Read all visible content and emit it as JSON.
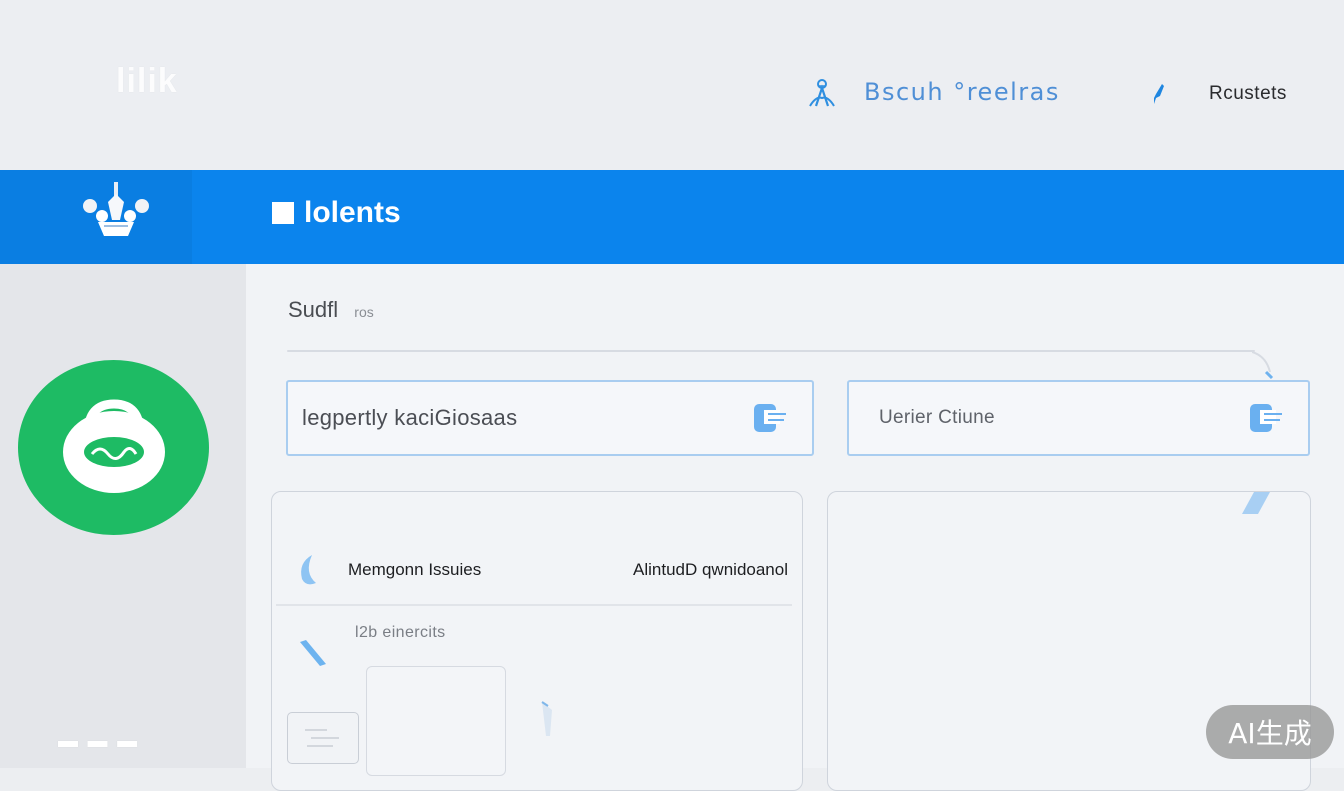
{
  "header": {
    "logo_text": "lilik",
    "search_text": "Bscuh °reelras",
    "requests_label": "Rcustets"
  },
  "titlebar": {
    "title": "lolents"
  },
  "sidebar": {
    "footer_text": "▬ ▬ ▬"
  },
  "main": {
    "section_title": "Sudfl",
    "section_sub": "ros",
    "fields": [
      {
        "value": "legpertly  kaciGiosaas",
        "icon": "document-icon"
      },
      {
        "value": "Uerier Ctiune",
        "icon": "document-icon"
      }
    ],
    "list": {
      "row1_label": "Memgonn Issuies",
      "row1_value": "AlintudD qwnidoanol",
      "row2_label": "l2b einercits"
    }
  },
  "badge": {
    "text": "AI生成"
  },
  "colors": {
    "accent_blue": "#0b84ed",
    "lock_green": "#1ebb64",
    "field_border": "#a9cdf0"
  }
}
